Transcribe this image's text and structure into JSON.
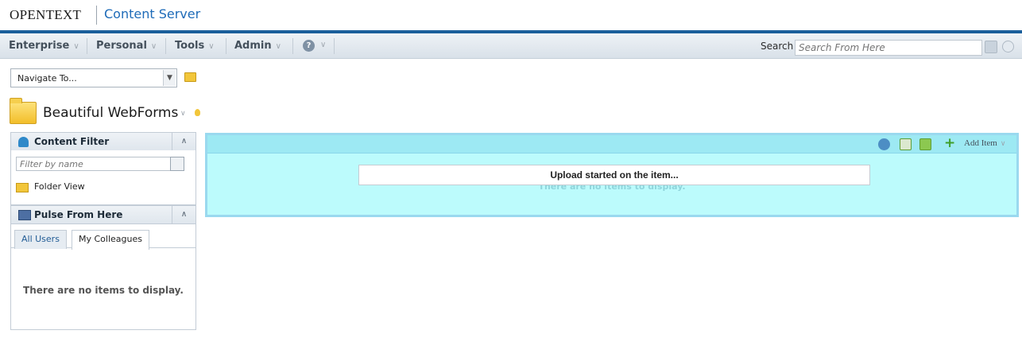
{
  "header": {
    "logo": "OPENTEXT",
    "product": "Content Server"
  },
  "menu": [
    {
      "label": "Enterprise"
    },
    {
      "label": "Personal"
    },
    {
      "label": "Tools"
    },
    {
      "label": "Admin"
    }
  ],
  "search": {
    "label": "Search",
    "placeholder": "Search From Here"
  },
  "navigate": {
    "value": "Navigate To..."
  },
  "page": {
    "title": "Beautiful WebForms"
  },
  "content_filter": {
    "title": "Content Filter",
    "filter_placeholder": "Filter by name",
    "folder_view": "Folder View"
  },
  "pulse": {
    "title": "Pulse From Here",
    "tabs": [
      "All Users",
      "My Colleagues"
    ],
    "empty_message": "There are no items to display."
  },
  "main": {
    "add_item": "Add Item",
    "empty_message": "There are no items to display.",
    "upload_message": "Upload started on the item..."
  },
  "colors": {
    "accent": "#1b5f9b",
    "drop_zone": "#bcfbfc",
    "add_green": "#3f9e2a"
  }
}
